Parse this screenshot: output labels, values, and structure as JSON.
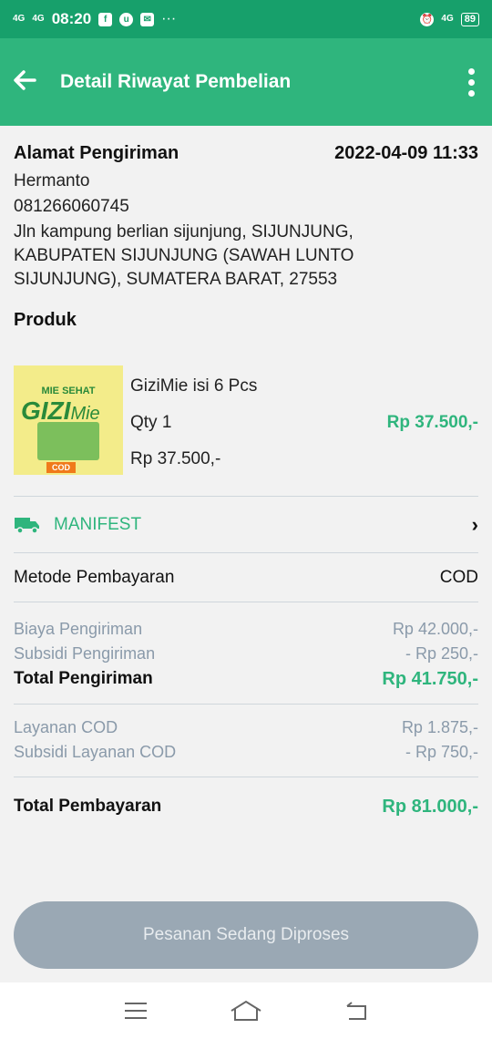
{
  "status_bar": {
    "network1": "4G",
    "network2": "4G",
    "time": "08:20",
    "more": "···",
    "network3": "4G",
    "battery": "89"
  },
  "header": {
    "title": "Detail Riwayat Pembelian"
  },
  "address": {
    "heading": "Alamat Pengiriman",
    "datetime": "2022-04-09 11:33",
    "name": "Hermanto",
    "phone": "081266060745",
    "line1": "Jln kampung berlian sijunjung, SIJUNJUNG,",
    "line2": "KABUPATEN SIJUNJUNG (SAWAH LUNTO",
    "line3": "SIJUNJUNG), SUMATERA BARAT, 27553"
  },
  "product": {
    "heading": "Produk",
    "name": "GiziMie isi 6 Pcs",
    "qty": "Qty 1",
    "unit_price": "Rp 37.500,-",
    "total": "Rp 37.500,-",
    "image_text": {
      "top": "MIE SEHAT",
      "brand": "GIZI",
      "script": "Mie",
      "badge": "COD"
    }
  },
  "manifest": {
    "label": "MANIFEST"
  },
  "payment": {
    "label": "Metode Pembayaran",
    "value": "COD"
  },
  "shipping": {
    "cost_label": "Biaya Pengiriman",
    "cost_value": "Rp 42.000,-",
    "subsidy_label": "Subsidi Pengiriman",
    "subsidy_value": "- Rp 250,-",
    "total_label": "Total Pengiriman",
    "total_value": "Rp 41.750,-"
  },
  "cod_service": {
    "fee_label": "Layanan COD",
    "fee_value": "Rp 1.875,-",
    "subsidy_label": "Subsidi Layanan COD",
    "subsidy_value": "- Rp 750,-"
  },
  "total": {
    "label": "Total Pembayaran",
    "value": "Rp 81.000,-"
  },
  "action": {
    "button_label": "Pesanan Sedang Diproses"
  },
  "colors": {
    "primary": "#2fb57d",
    "status_bar": "#17a06b",
    "button_disabled": "#9aa8b4"
  },
  "icons": [
    "back-arrow-icon",
    "more-vert-icon",
    "truck-icon",
    "chevron-right-icon",
    "menu-icon",
    "home-icon",
    "return-icon"
  ]
}
